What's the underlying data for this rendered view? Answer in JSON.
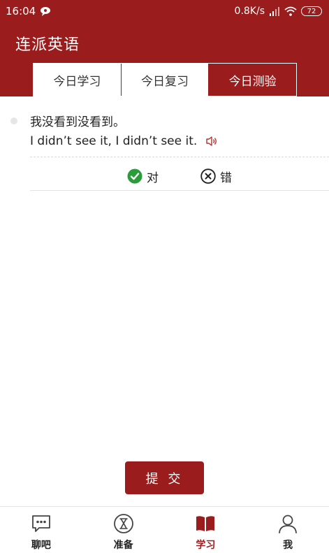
{
  "status_bar": {
    "time": "16:04",
    "network_speed": "0.8K/s",
    "battery": "72"
  },
  "header": {
    "title": "连派英语"
  },
  "tabs": [
    {
      "label": "今日学习",
      "active": false
    },
    {
      "label": "今日复习",
      "active": false
    },
    {
      "label": "今日测验",
      "active": true
    }
  ],
  "question": {
    "chinese": "我没看到没看到。",
    "english": "I didn’t see it, I didn’t see it."
  },
  "answers": {
    "correct_label": "对",
    "wrong_label": "错"
  },
  "submit_label": "提 交",
  "bottom_nav": [
    {
      "label": "聊吧",
      "icon": "chat-icon",
      "active": false
    },
    {
      "label": "准备",
      "icon": "hourglass-icon",
      "active": false
    },
    {
      "label": "学习",
      "icon": "book-icon",
      "active": true
    },
    {
      "label": "我",
      "icon": "profile-icon",
      "active": false
    }
  ],
  "colors": {
    "brand": "#9b1c1c",
    "correct": "#2a9d3a"
  }
}
